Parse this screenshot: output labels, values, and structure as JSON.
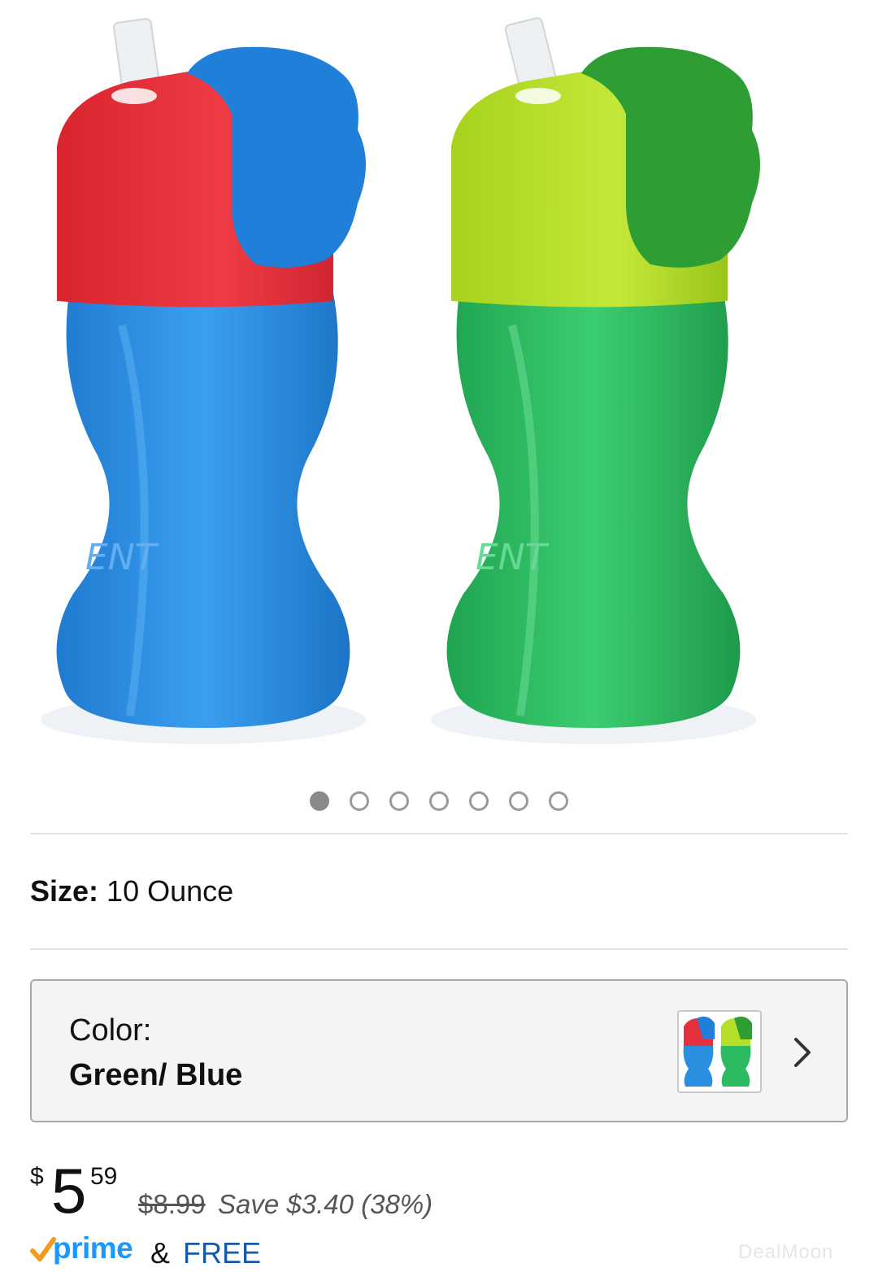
{
  "gallery": {
    "image_count": 7,
    "active_index": 0,
    "cups": [
      {
        "name": "blue-red-cup",
        "lid_color": "#e5303d",
        "flap_color": "#1f7fd9",
        "body_color": "#2a8fe0",
        "brand_text": "ENT"
      },
      {
        "name": "green-lime-cup",
        "lid_color": "#b6df2a",
        "flap_color": "#2e9e34",
        "body_color": "#2dbb62",
        "brand_text": "ENT"
      }
    ]
  },
  "size": {
    "label": "Size:",
    "value": "10 Ounce"
  },
  "color": {
    "label": "Color:",
    "value": "Green/ Blue"
  },
  "price": {
    "currency": "$",
    "whole": "5",
    "cents": "59",
    "original": "$8.99",
    "savings": "Save $3.40 (38%)"
  },
  "shipping": {
    "prime_label": "prime",
    "ampersand": "&",
    "returns": "FREE Returns"
  },
  "watermark": "DealMoon",
  "colors": {
    "accent_link": "#1559a8",
    "prime_blue": "#1a98ff",
    "prime_check": "#f39a1b"
  }
}
